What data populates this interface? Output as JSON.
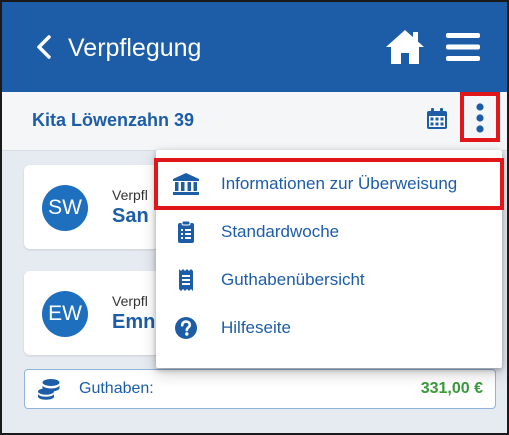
{
  "header": {
    "title": "Verpflegung",
    "back_icon": "chevron-left-icon",
    "home_icon": "home-icon",
    "menu_icon": "hamburger-menu-icon",
    "background_color": "#1d5da8"
  },
  "subheader": {
    "kita_name": "Kita Löwenzahn 39",
    "calendar_icon": "calendar-icon",
    "more_icon": "kebab-menu-icon"
  },
  "children": [
    {
      "initials": "SW",
      "label": "Verpfl",
      "name": "San"
    },
    {
      "initials": "EW",
      "label": "Verpfl",
      "name": "Emn"
    }
  ],
  "balance": {
    "label": "Guthaben:",
    "value": "331,00 €",
    "icon": "coins-icon",
    "value_color": "#3a9a3a"
  },
  "dropdown": {
    "items": [
      {
        "label": "Informationen zur Überweisung",
        "icon": "bank-icon",
        "highlighted": true
      },
      {
        "label": "Standardwoche",
        "icon": "clipboard-list-icon"
      },
      {
        "label": "Guthabenübersicht",
        "icon": "receipt-icon"
      },
      {
        "label": "Hilfeseite",
        "icon": "question-circle-icon"
      }
    ]
  },
  "highlight_color": "#e0161b"
}
